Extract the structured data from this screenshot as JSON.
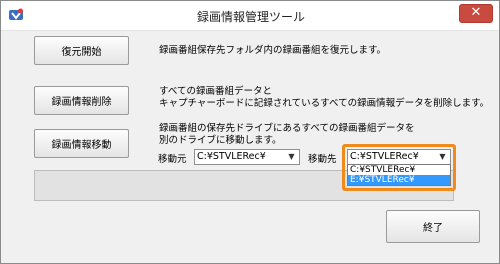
{
  "window": {
    "title": "録画情報管理ツール",
    "close_label": "✕"
  },
  "actions": [
    {
      "button_label": "復元開始",
      "description_lines": [
        "録画番組保存先フォルダ内の録画番組を復元します。"
      ]
    },
    {
      "button_label": "録画情報削除",
      "description_lines": [
        "すべての録画番組データと",
        "キャプチャーボードに記録されているすべての録画情報データを削除します。"
      ]
    },
    {
      "button_label": "録画情報移動",
      "description_lines": [
        "録画番組の保存先ドライブにあるすべての録画番組データを",
        "別のドライブに移動します。"
      ]
    }
  ],
  "move": {
    "source_label": "移動元",
    "source_value": "C:¥STVLERec¥",
    "dest_label": "移動先",
    "dest_value": "C:¥STVLERec¥",
    "dest_options": [
      "C:¥STVLERec¥",
      "E:¥STVLERec¥"
    ],
    "selected_option_index": 1
  },
  "progress": {
    "value": 0
  },
  "footer": {
    "close_button_label": "終了"
  },
  "colors": {
    "highlight": "#f08a1c",
    "selection": "#3399ff",
    "close": "#c94a3f"
  },
  "icons": {
    "app": "app-icon",
    "dropdown": "chevron-down-icon"
  }
}
